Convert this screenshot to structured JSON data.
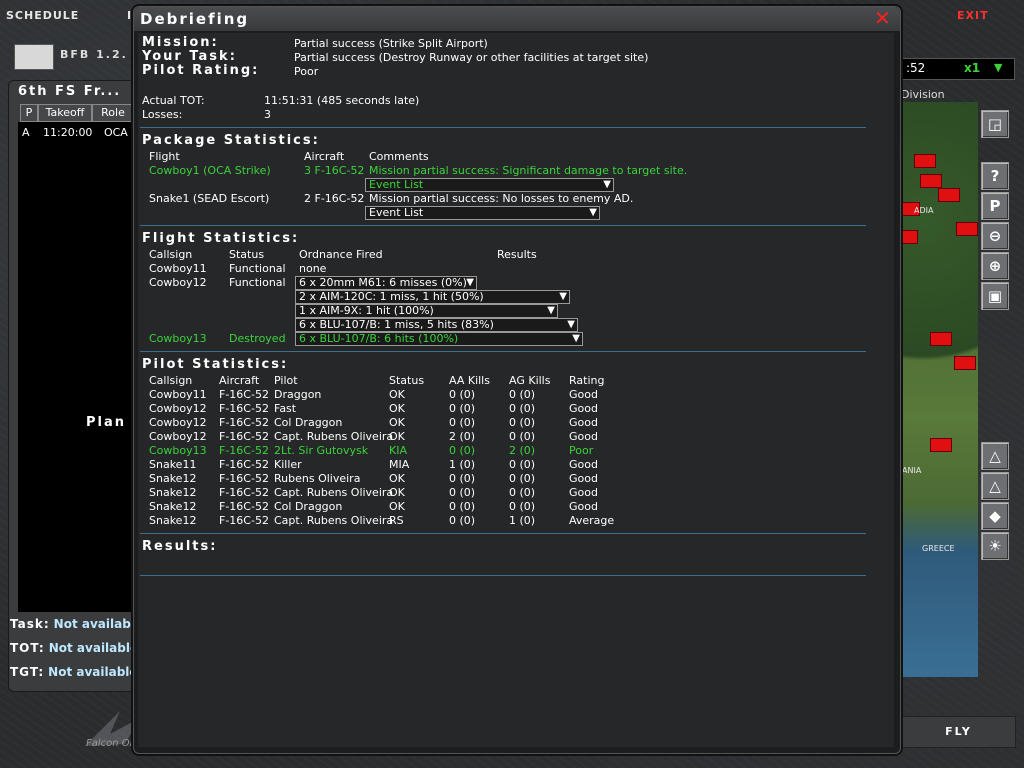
{
  "topbar": {
    "schedule": "SCHEDULE",
    "cut": "I",
    "exit": "EXIT"
  },
  "left": {
    "logo_text": "BFB 1.2.",
    "squad_title": "6th FS Fr...",
    "headers": [
      "P",
      "Takeoff",
      "Role"
    ],
    "row": {
      "p": "A",
      "takeoff": "11:20:00",
      "role": "OCA Str"
    },
    "planning": "Plan",
    "task_label": "Task:",
    "task_value": "Not available",
    "tot_label": "TOT:",
    "tot_value": "Not available",
    "tgt_label": "TGT:",
    "tgt_value": "Not available"
  },
  "map": {
    "time": ":52",
    "speed": "x1",
    "division": "Division",
    "labels": [
      "ADIA",
      "ANIA",
      "GREECE"
    ]
  },
  "fly": "FLY",
  "falcon_text": "Falcon Online",
  "debrief": {
    "title": "Debriefing",
    "mission_label": "Mission:",
    "your_task_label": "Your Task:",
    "pilot_rating_label": "Pilot Rating:",
    "mission_value": "Partial success   (Strike Split Airport)",
    "task_value": "Partial success   (Destroy Runway or other facilities at target site)",
    "rating_value": "Poor",
    "actual_tot_label": "Actual TOT:",
    "actual_tot_value": "11:51:31 (485 seconds late)",
    "losses_label": "Losses:",
    "losses_value": "3",
    "package_title": "Package Statistics:",
    "package_headers": {
      "flight": "Flight",
      "aircraft": "Aircraft",
      "comments": "Comments"
    },
    "package_rows": [
      {
        "flight": "Cowboy1 (OCA Strike)",
        "aircraft": "3 F-16C-52",
        "comment": "Mission partial success: Significant damage to target site.",
        "event": "Event List"
      },
      {
        "flight": "Snake1 (SEAD Escort)",
        "aircraft": "2 F-16C-52",
        "comment": "Mission partial success: No losses to enemy AD.",
        "event": "Event List"
      }
    ],
    "flight_title": "Flight Statistics:",
    "flight_headers": {
      "callsign": "Callsign",
      "status": "Status",
      "ordnance": "Ordnance Fired",
      "results": "Results"
    },
    "flight_rows": [
      {
        "callsign": "Cowboy11",
        "status": "Functional",
        "ordnance": "none"
      },
      {
        "callsign": "Cowboy12",
        "status": "Functional"
      },
      {
        "callsign": "Cowboy13",
        "status": "Destroyed"
      }
    ],
    "ordnance": [
      "6 x 20mm M61: 6 misses (0%)",
      "2 x AIM-120C: 1 miss, 1 hit (50%)",
      "1 x AIM-9X: 1 hit (100%)",
      "6 x BLU-107/B: 1 miss, 5 hits (83%)",
      "6 x BLU-107/B: 6 hits (100%)"
    ],
    "pilot_title": "Pilot Statistics:",
    "pilot_headers": {
      "callsign": "Callsign",
      "aircraft": "Aircraft",
      "pilot": "Pilot",
      "status": "Status",
      "aa": "AA Kills",
      "ag": "AG Kills",
      "rating": "Rating"
    },
    "pilot_rows": [
      {
        "callsign": "Cowboy11",
        "aircraft": "F-16C-52",
        "pilot": "Draggon",
        "status": "OK",
        "aa": "0 (0)",
        "ag": "0 (0)",
        "rating": "Good"
      },
      {
        "callsign": "Cowboy12",
        "aircraft": "F-16C-52",
        "pilot": "Fast",
        "status": "OK",
        "aa": "0 (0)",
        "ag": "0 (0)",
        "rating": "Good"
      },
      {
        "callsign": "Cowboy12",
        "aircraft": "F-16C-52",
        "pilot": "Col Draggon",
        "status": "OK",
        "aa": "0 (0)",
        "ag": "0 (0)",
        "rating": "Good"
      },
      {
        "callsign": "Cowboy12",
        "aircraft": "F-16C-52",
        "pilot": "Capt. Rubens Oliveira",
        "status": "OK",
        "aa": "2 (0)",
        "ag": "0 (0)",
        "rating": "Good"
      },
      {
        "callsign": "Cowboy13",
        "aircraft": "F-16C-52",
        "pilot": "2Lt. Sir Gutovysk",
        "status": "KIA",
        "aa": "0 (0)",
        "ag": "2 (0)",
        "rating": "Poor"
      },
      {
        "callsign": "Snake11",
        "aircraft": "F-16C-52",
        "pilot": "Killer",
        "status": "MIA",
        "aa": "1 (0)",
        "ag": "0 (0)",
        "rating": "Good"
      },
      {
        "callsign": "Snake12",
        "aircraft": "F-16C-52",
        "pilot": "Rubens Oliveira",
        "status": "OK",
        "aa": "0 (0)",
        "ag": "0 (0)",
        "rating": "Good"
      },
      {
        "callsign": "Snake12",
        "aircraft": "F-16C-52",
        "pilot": "Capt. Rubens Oliveira",
        "status": "OK",
        "aa": "0 (0)",
        "ag": "0 (0)",
        "rating": "Good"
      },
      {
        "callsign": "Snake12",
        "aircraft": "F-16C-52",
        "pilot": "Col Draggon",
        "status": "OK",
        "aa": "0 (0)",
        "ag": "0 (0)",
        "rating": "Good"
      },
      {
        "callsign": "Snake12",
        "aircraft": "F-16C-52",
        "pilot": "Capt. Rubens Oliveira",
        "status": "RS",
        "aa": "0 (0)",
        "ag": "1 (0)",
        "rating": "Average"
      }
    ],
    "results_title": "Results:"
  },
  "colors": {
    "accent_green": "#3cd23c",
    "exit_red": "#ff3030",
    "separator": "#3c6e8e"
  }
}
